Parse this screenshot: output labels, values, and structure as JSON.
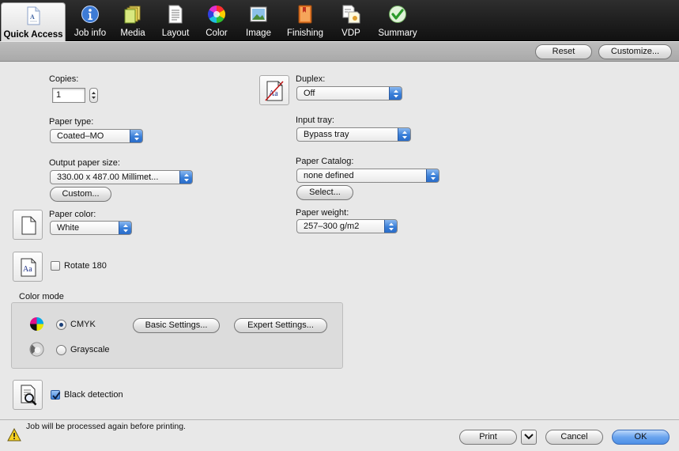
{
  "tabs": [
    {
      "label": "Quick Access",
      "icon": "quick-access-doc-icon",
      "active": true
    },
    {
      "label": "Job info",
      "icon": "info-icon"
    },
    {
      "label": "Media",
      "icon": "media-paper-stack-icon"
    },
    {
      "label": "Layout",
      "icon": "layout-page-icon"
    },
    {
      "label": "Color",
      "icon": "color-wheel-icon"
    },
    {
      "label": "Image",
      "icon": "image-picture-icon"
    },
    {
      "label": "Finishing",
      "icon": "finishing-book-icon"
    },
    {
      "label": "VDP",
      "icon": "vdp-icon"
    },
    {
      "label": "Summary",
      "icon": "summary-checkmark-icon"
    }
  ],
  "strip": {
    "reset": "Reset",
    "customize": "Customize..."
  },
  "copies": {
    "label": "Copies:",
    "value": "1"
  },
  "paper_type": {
    "label": "Paper type:",
    "value": "Coated–MO"
  },
  "output_paper_size": {
    "label": "Output paper size:",
    "value": "330.00 x 487.00 Millimet...",
    "custom": "Custom..."
  },
  "paper_color": {
    "label": "Paper color:",
    "value": "White"
  },
  "rotate": {
    "label": "Rotate 180",
    "checked": false
  },
  "duplex": {
    "label": "Duplex:",
    "value": "Off"
  },
  "input_tray": {
    "label": "Input tray:",
    "value": "Bypass tray"
  },
  "paper_catalog": {
    "label": "Paper Catalog:",
    "value": "none defined",
    "select": "Select..."
  },
  "paper_weight": {
    "label": "Paper weight:",
    "value": "257–300 g/m2"
  },
  "color_mode": {
    "label": "Color mode",
    "cmyk": "CMYK",
    "grayscale": "Grayscale",
    "selected": "CMYK",
    "basic": "Basic Settings...",
    "expert": "Expert Settings..."
  },
  "black_detection": {
    "label": "Black detection",
    "checked": true
  },
  "footer": {
    "message": "Job will be processed again before printing.",
    "print": "Print",
    "cancel": "Cancel",
    "ok": "OK"
  },
  "colors": {
    "accent": "#3a7fd8",
    "toolbar": "#1e1e1e"
  }
}
